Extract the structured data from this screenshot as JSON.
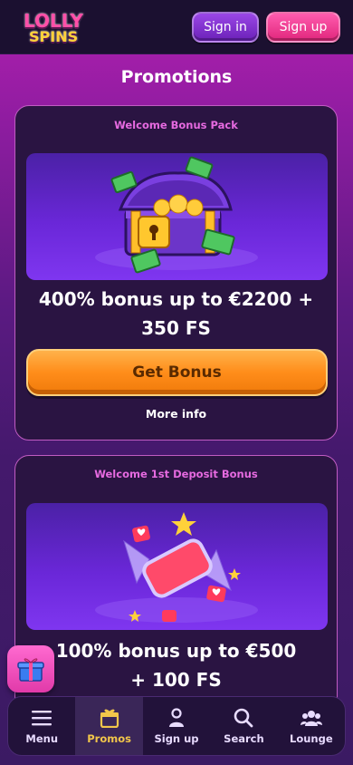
{
  "header": {
    "logo_line1": "LOLLY",
    "logo_line2": "SPINS",
    "signin_label": "Sign in",
    "signup_label": "Sign up"
  },
  "page_title": "Promotions",
  "promos": [
    {
      "label": "Welcome Bonus Pack",
      "offer_line1": "400% bonus up to €2200 +",
      "offer_line2": "350 FS",
      "button_label": "Get Bonus",
      "more_info_label": "More info",
      "banner_icon": "treasure-chest-icon"
    },
    {
      "label": "Welcome 1st Deposit Bonus",
      "offer_line1": "100% bonus up to €500",
      "offer_line2": "+ 100 FS",
      "banner_icon": "candy-icon"
    }
  ],
  "nav": {
    "items": [
      {
        "label": "Menu",
        "icon": "menu-icon"
      },
      {
        "label": "Promos",
        "icon": "gift-box-icon"
      },
      {
        "label": "Sign up",
        "icon": "user-add-icon"
      },
      {
        "label": "Search",
        "icon": "search-icon"
      },
      {
        "label": "Lounge",
        "icon": "group-icon"
      }
    ],
    "active_index": 1
  },
  "colors": {
    "accent_orange": "#ff8d1a",
    "accent_pink": "#e66ae0",
    "active_nav": "#f2c64a",
    "card_border": "#c05cc2"
  }
}
